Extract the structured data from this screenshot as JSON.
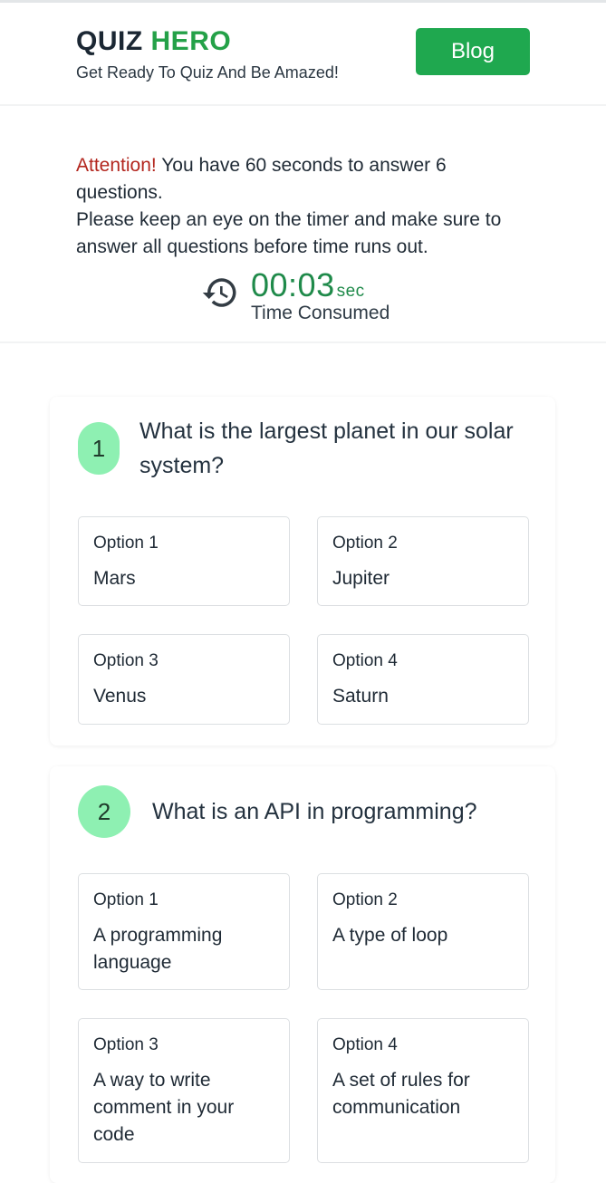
{
  "header": {
    "logo_part1": "QUIZ",
    "logo_part2": "HERO",
    "tagline": "Get Ready To Quiz And Be Amazed!",
    "blog_label": "Blog"
  },
  "notice": {
    "attention": "Attention!",
    "line1": " You have 60 seconds to answer 6 questions.",
    "line2": "Please keep an eye on the timer and make sure to answer all questions before time runs out."
  },
  "timer": {
    "icon": "history-icon",
    "value": "00:03",
    "unit": "sec",
    "label": "Time Consumed"
  },
  "questions": [
    {
      "number": "1",
      "text": "What is the largest planet in our solar system?",
      "options": [
        {
          "label": "Option 1",
          "text": "Mars"
        },
        {
          "label": "Option 2",
          "text": "Jupiter"
        },
        {
          "label": "Option 3",
          "text": "Venus"
        },
        {
          "label": "Option 4",
          "text": "Saturn"
        }
      ]
    },
    {
      "number": "2",
      "text": "What is an API in programming?",
      "options": [
        {
          "label": "Option 1",
          "text": "A programming language"
        },
        {
          "label": "Option 2",
          "text": "A type of loop"
        },
        {
          "label": "Option 3",
          "text": "A way to write comment in your code"
        },
        {
          "label": "Option 4",
          "text": "A set of rules for communication"
        }
      ]
    }
  ],
  "colors": {
    "brand_green": "#24a148",
    "button_green": "#1fa84f",
    "attention_red": "#b3261e",
    "timer_green": "#1f8a4a",
    "badge_green": "#8ef0b2"
  }
}
